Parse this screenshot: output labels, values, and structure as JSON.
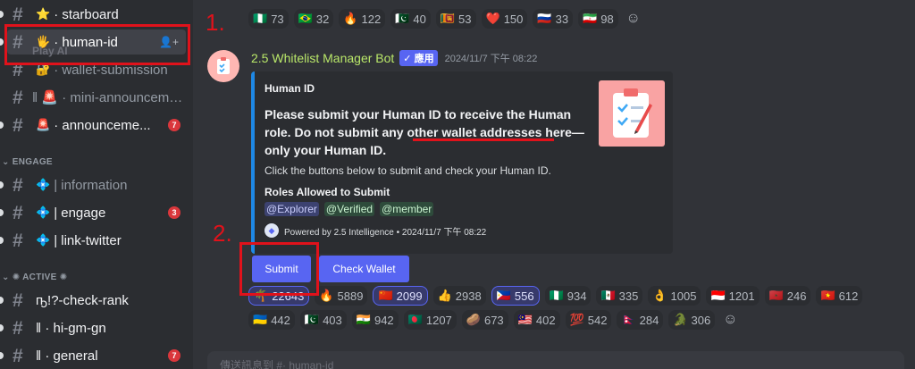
{
  "sidebar": {
    "play_ai": "Play AI",
    "channels_top": [
      {
        "emoji": "⭐",
        "label": "· starboard",
        "state": "bright"
      },
      {
        "emoji": "🖐",
        "label": "· human-id",
        "state": "active"
      },
      {
        "emoji": "🔐",
        "label": "· wallet-submission",
        "state": "muted"
      },
      {
        "emoji": "🚨",
        "label": "‖ 🚨 · mini-announceme...",
        "state": "muted"
      },
      {
        "emoji": "🚨",
        "label": "· announceme...",
        "state": "bright",
        "badge": "7"
      }
    ],
    "category_engage": "ENGAGE",
    "channels_engage": [
      {
        "emoji": "💠",
        "label": "| information",
        "state": "muted"
      },
      {
        "emoji": "💠",
        "label": "| engage",
        "state": "bright",
        "badge": "3"
      },
      {
        "emoji": "💠",
        "label": "| link-twitter",
        "state": "bright"
      }
    ],
    "category_active": "✺ ACTIVE ✺",
    "channels_active": [
      {
        "emoji": "",
        "label": "ҧ!?-check-rank",
        "state": "bright"
      },
      {
        "emoji": "",
        "label": "‖ · hi-gm-gn",
        "state": "bright"
      },
      {
        "emoji": "",
        "label": "‖ · general",
        "state": "bright",
        "badge": "7"
      }
    ]
  },
  "annotations": {
    "step1": "1.",
    "step2": "2."
  },
  "top_reactions": [
    {
      "emoji": "🇳🇬",
      "count": "73"
    },
    {
      "emoji": "🇧🇷",
      "count": "32"
    },
    {
      "emoji": "🔥",
      "count": "122"
    },
    {
      "emoji": "🇵🇰",
      "count": "40"
    },
    {
      "emoji": "🇱🇰",
      "count": "53"
    },
    {
      "emoji": "❤️",
      "count": "150"
    },
    {
      "emoji": "🇷🇺",
      "count": "33"
    },
    {
      "emoji": "🇮🇷",
      "count": "98"
    }
  ],
  "message": {
    "author": "2.5 Whitelist Manager Bot",
    "app_tag": "✓ 應用",
    "timestamp": "2024/11/7 下午 08:22",
    "embed": {
      "author": "Human ID",
      "desc_line1": "Please submit your Human ID to receive the Human",
      "desc_line2": "role. Do not submit any other wallet addresses here—",
      "desc_line3": "only your Human ID.",
      "hint": "Click the buttons below to submit and check your Human ID.",
      "field_title": "Roles Allowed to Submit",
      "roles": [
        "@Explorer",
        "@Verified",
        "@member"
      ],
      "footer": "Powered by 2.5 Intelligence • 2024/11/7 下午 08:22"
    },
    "buttons": {
      "submit": "Submit",
      "check": "Check Wallet"
    }
  },
  "reactions_row1": [
    {
      "emoji": "🌴",
      "count": "22643",
      "me": true
    },
    {
      "emoji": "🔥",
      "count": "5889"
    },
    {
      "emoji": "🇨🇳",
      "count": "2099",
      "me": true
    },
    {
      "emoji": "👍",
      "count": "2938"
    },
    {
      "emoji": "🇵🇭",
      "count": "556",
      "me": true
    },
    {
      "emoji": "🇳🇬",
      "count": "934"
    },
    {
      "emoji": "🇲🇽",
      "count": "335"
    },
    {
      "emoji": "👌",
      "count": "1005"
    },
    {
      "emoji": "🇮🇩",
      "count": "1201"
    },
    {
      "emoji": "🇲🇦",
      "count": "246"
    },
    {
      "emoji": "🇻🇳",
      "count": "612"
    }
  ],
  "reactions_row2": [
    {
      "emoji": "🇺🇦",
      "count": "442"
    },
    {
      "emoji": "🇵🇰",
      "count": "403"
    },
    {
      "emoji": "🇮🇳",
      "count": "942"
    },
    {
      "emoji": "🇧🇩",
      "count": "1207"
    },
    {
      "emoji": "🥔",
      "count": "673"
    },
    {
      "emoji": "🇲🇾",
      "count": "402"
    },
    {
      "emoji": "💯",
      "count": "542"
    },
    {
      "emoji": "🇳🇵",
      "count": "284"
    },
    {
      "emoji": "🐊",
      "count": "306"
    }
  ],
  "composer": {
    "placeholder": "傳送訊息到 #· human-id"
  }
}
